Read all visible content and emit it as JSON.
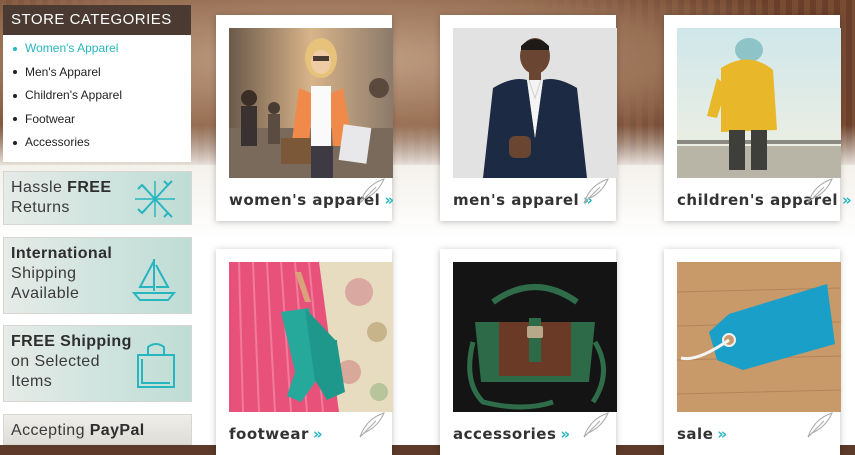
{
  "categories": {
    "title": "STORE CATEGORIES",
    "items": [
      "Women's Apparel",
      "Men's Apparel",
      "Children's Apparel",
      "Footwear",
      "Accessories"
    ]
  },
  "promos": {
    "returns": {
      "line1_pre": "Hassle ",
      "line1_bold": "FREE",
      "line2": "Returns"
    },
    "international": {
      "line1_bold": "International",
      "line2": "Shipping",
      "line3": "Available"
    },
    "free_shipping": {
      "line1_bold": "FREE Shipping",
      "line2": "on Selected",
      "line3": "Items"
    },
    "paypal": {
      "line1_pre": "Accepting ",
      "line1_bold": "PayPal"
    }
  },
  "products": {
    "women": "women's apparel",
    "men": "men's apparel",
    "children": "children's apparel",
    "footwear": "footwear",
    "accessories": "accessories",
    "sale": "sale",
    "arrow": "»"
  },
  "colors": {
    "accent": "#27b5c0",
    "category_header": "#4a3a32"
  },
  "icons": [
    "returns-arrows-icon",
    "sailboat-icon",
    "shopping-bag-icon",
    "feather-icon",
    "double-chevron-icon"
  ]
}
